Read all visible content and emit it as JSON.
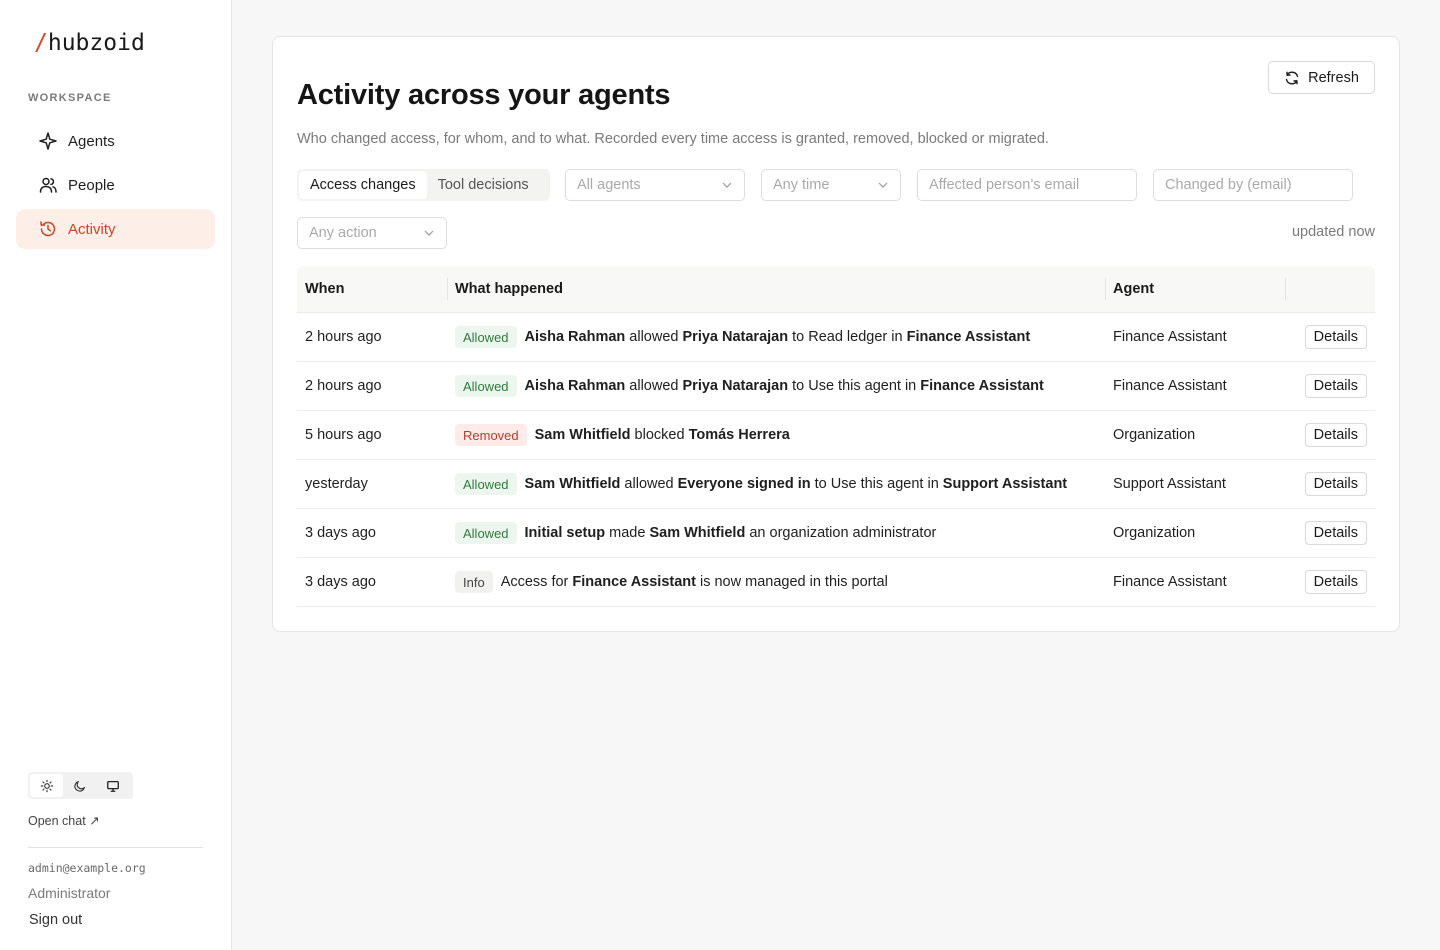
{
  "brand": {
    "slash": "/",
    "name": "hubzoid"
  },
  "sidebar": {
    "section_label": "WORKSPACE",
    "items": [
      {
        "label": "Agents",
        "icon": "sparkle-icon",
        "active": false
      },
      {
        "label": "People",
        "icon": "people-icon",
        "active": false
      },
      {
        "label": "Activity",
        "icon": "history-icon",
        "active": true
      }
    ],
    "theme_options": [
      "sun-icon",
      "moon-icon",
      "monitor-icon"
    ],
    "open_chat": "Open chat ↗",
    "user_email": "admin@example.org",
    "user_role": "Administrator",
    "sign_out": "Sign out"
  },
  "colors": {
    "accent": "#d24a2a",
    "active_bg": "#fdeee8",
    "allowed": "#2f7a3d",
    "removed": "#b3402c"
  },
  "main": {
    "title": "Activity across your agents",
    "subtitle": "Who changed access, for whom, and to what. Recorded every time access is granted, removed, blocked or migrated.",
    "refresh_label": "Refresh",
    "tabs": [
      {
        "label": "Access changes",
        "active": true
      },
      {
        "label": "Tool decisions",
        "active": false
      }
    ],
    "filters": {
      "agent_select": "All agents",
      "time_select": "Any time",
      "affected_placeholder": "Affected person’s email",
      "changed_by_placeholder": "Changed by (email)",
      "action_select": "Any action"
    },
    "updated": "updated now",
    "table": {
      "headers": {
        "when": "When",
        "what": "What happened",
        "agent": "Agent"
      },
      "details_label": "Details",
      "rows": [
        {
          "when": "2 hours ago",
          "badge": "Allowed",
          "badge_type": "allowed",
          "parts": [
            [
              "b",
              "Aisha Rahman"
            ],
            [
              "t",
              " allowed "
            ],
            [
              "b",
              "Priya Natarajan"
            ],
            [
              "t",
              " to Read ledger in "
            ],
            [
              "b",
              "Finance Assistant"
            ]
          ],
          "agent": "Finance Assistant"
        },
        {
          "when": "2 hours ago",
          "badge": "Allowed",
          "badge_type": "allowed",
          "parts": [
            [
              "b",
              "Aisha Rahman"
            ],
            [
              "t",
              " allowed "
            ],
            [
              "b",
              "Priya Natarajan"
            ],
            [
              "t",
              " to Use this agent in "
            ],
            [
              "b",
              "Finance Assistant"
            ]
          ],
          "agent": "Finance Assistant"
        },
        {
          "when": "5 hours ago",
          "badge": "Removed",
          "badge_type": "removed",
          "parts": [
            [
              "b",
              "Sam Whitfield"
            ],
            [
              "t",
              " blocked "
            ],
            [
              "b",
              "Tomás Herrera"
            ]
          ],
          "agent": "Organization"
        },
        {
          "when": "yesterday",
          "badge": "Allowed",
          "badge_type": "allowed",
          "parts": [
            [
              "b",
              "Sam Whitfield"
            ],
            [
              "t",
              " allowed "
            ],
            [
              "b",
              "Everyone signed in"
            ],
            [
              "t",
              " to Use this agent in "
            ],
            [
              "b",
              "Support Assistant"
            ]
          ],
          "agent": "Support Assistant"
        },
        {
          "when": "3 days ago",
          "badge": "Allowed",
          "badge_type": "allowed",
          "parts": [
            [
              "b",
              "Initial setup"
            ],
            [
              "t",
              " made "
            ],
            [
              "b",
              "Sam Whitfield"
            ],
            [
              "t",
              " an organization administrator"
            ]
          ],
          "agent": "Organization"
        },
        {
          "when": "3 days ago",
          "badge": "Info",
          "badge_type": "info",
          "parts": [
            [
              "t",
              "Access for "
            ],
            [
              "b",
              "Finance Assistant"
            ],
            [
              "t",
              " is now managed in this portal"
            ]
          ],
          "agent": "Finance Assistant"
        }
      ]
    }
  }
}
